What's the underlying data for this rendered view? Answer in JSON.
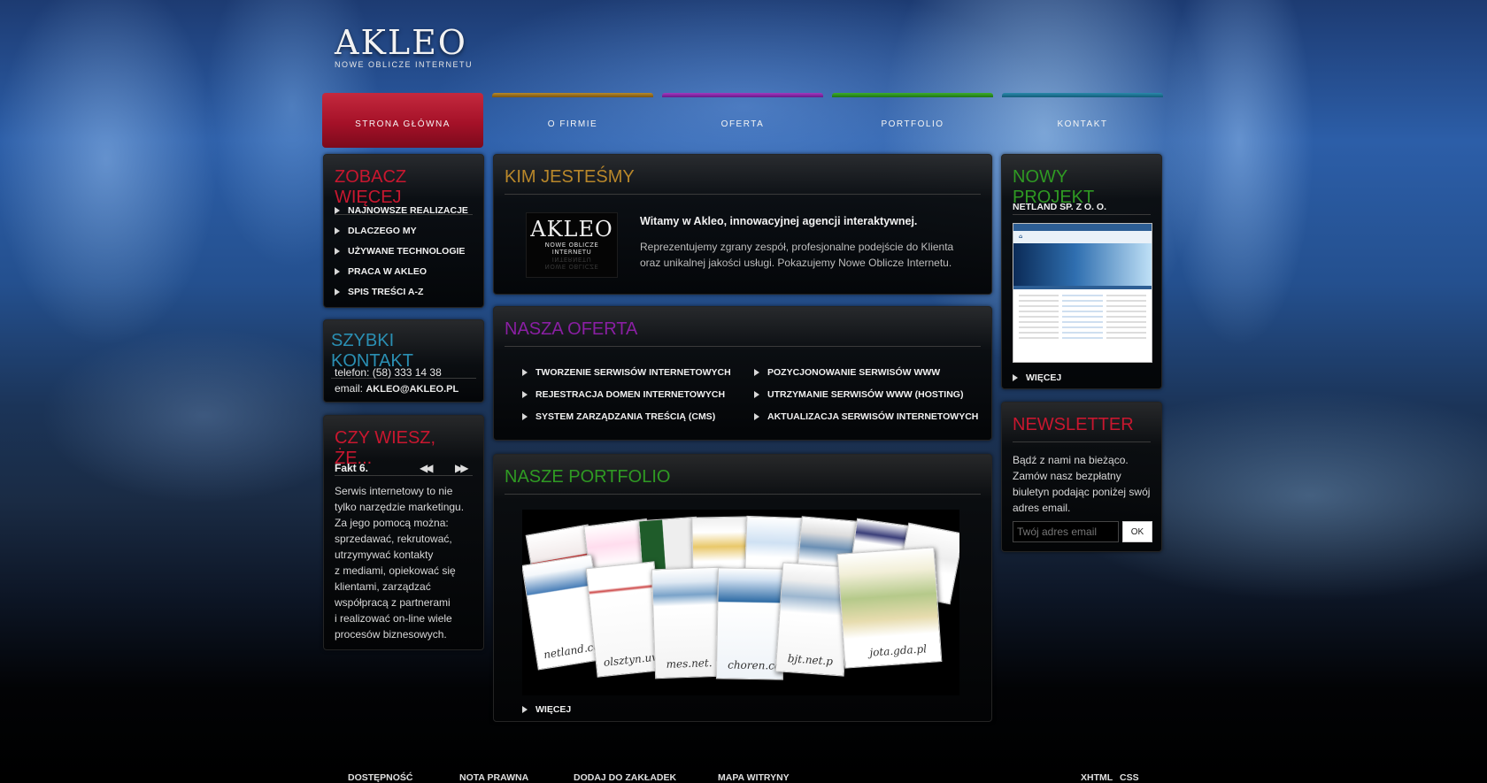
{
  "logo": {
    "name": "AKLEO",
    "tagline": "NOWE OBLICZE INTERNETU"
  },
  "nav": [
    {
      "label": "STRONA GŁÓWNA",
      "color": "#b5162e"
    },
    {
      "label": "O FIRMIE",
      "color": "#9a6a1a"
    },
    {
      "label": "OFERTA",
      "color": "#7a1d94"
    },
    {
      "label": "PORTFOLIO",
      "color": "#2a8a1e"
    },
    {
      "label": "KONTAKT",
      "color": "#1e6f8a"
    }
  ],
  "see_more": {
    "title": "ZOBACZ WIĘCEJ",
    "title_color": "#c8172f",
    "items": [
      "NAJNOWSZE REALIZACJE",
      "DLACZEGO MY",
      "UŻYWANE TECHNOLOGIE",
      "PRACA W AKLEO",
      "SPIS TREŚCI A-Z"
    ]
  },
  "quick_contact": {
    "title": "SZYBKI KONTAKT",
    "title_color": "#2a8fb3",
    "phone_label": "telefon:",
    "phone": "(58) 333 14 38",
    "email_label": "email:",
    "email": "AKLEO@AKLEO.PL"
  },
  "did_you_know": {
    "title": "CZY WIESZ, ŻE...",
    "title_color": "#c8172f",
    "fact_label": "Fakt 6.",
    "prev_icon": "double-left-arrow",
    "next_icon": "double-right-arrow",
    "lines": [
      "Serwis internetowy to nie",
      "tylko narzędzie marketingu.",
      "Za jego pomocą można:",
      "sprzedawać, rekrutować,",
      "utrzymywać kontakty",
      "z mediami, opiekować się",
      "klientami, zarządzać",
      "współpracą z partnerami",
      "i realizować on-line wiele",
      "procesów biznesowych."
    ]
  },
  "who_we_are": {
    "title": "KIM JESTEŚMY",
    "title_color": "#b8872a",
    "logo_name": "AKLEO",
    "logo_tagline": "NOWE OBLICZE INTERNETU",
    "heading": "Witamy w Akleo, innowacyjnej agencji interaktywnej.",
    "line1": "Reprezentujemy zgrany zespół, profesjonalne podejście do Klienta",
    "line2": "oraz unikalnej jakości usługi. Pokazujemy Nowe Oblicze Internetu."
  },
  "offer": {
    "title": "NASZA OFERTA",
    "title_color": "#8a1fa3",
    "left": [
      "TWORZENIE SERWISÓW INTERNETOWYCH",
      "REJESTRACJA DOMEN INTERNETOWYCH",
      "SYSTEM ZARZĄDZANIA TREŚCIĄ  (CMS)"
    ],
    "right": [
      "POZYCJONOWANIE SERWISÓW WWW",
      "UTRZYMANIE SERWISÓW WWW  (HOSTING)",
      "AKTUALIZACJA SERWISÓW INTERNETOWYCH"
    ]
  },
  "portfolio": {
    "title": "NASZE PORTFOLIO",
    "title_color": "#2f9a23",
    "labels": [
      "netland.co",
      "olsztyn.uw.g",
      "mes.net.",
      "choren.co",
      "bjt.net.p",
      "jota.gda.pl"
    ],
    "more": "WIĘCEJ"
  },
  "new_project": {
    "title": "NOWY PROJEKT",
    "title_color": "#2f9a23",
    "client": "NETLAND SP. Z O. O.",
    "more": "WIĘCEJ"
  },
  "newsletter": {
    "title": "NEWSLETTER",
    "title_color": "#c8172f",
    "lines": [
      "Bądź z nami na bieżąco.",
      "Zamów nasz bezpłatny",
      "biuletyn podając poniżej swój",
      "adres email."
    ],
    "placeholder": "Twój adres email",
    "button": "OK"
  },
  "footer": {
    "links": [
      "DOSTĘPNOŚĆ",
      "NOTA PRAWNA",
      "DODAJ DO ZAKŁADEK",
      "MAPA WITRYNY"
    ],
    "xhtml": "XHTML",
    "css": "CSS"
  }
}
